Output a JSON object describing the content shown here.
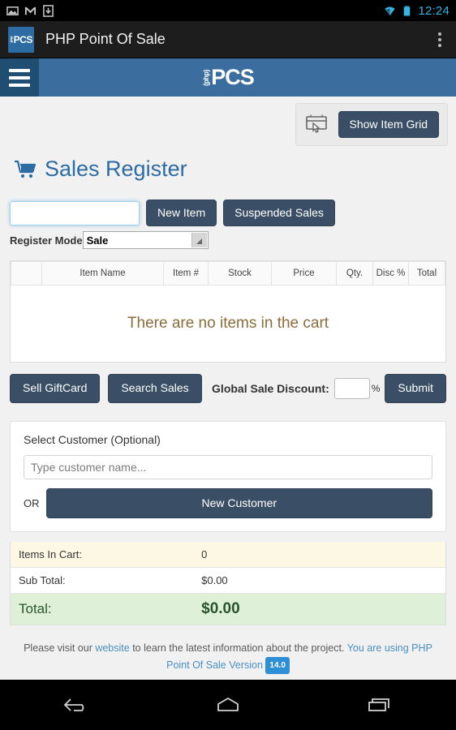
{
  "statusbar": {
    "icons": [
      "image-icon",
      "mail-icon",
      "download-icon",
      "wifi-icon",
      "battery-icon"
    ],
    "clock": "12:24"
  },
  "appbar": {
    "logo_text": "PCS",
    "logo_php": "(php)",
    "title": "PHP Point Of Sale",
    "overflow": "overflow-menu"
  },
  "sitenav": {
    "menu_icon": "hamburger-icon",
    "logo_php": "(php)",
    "logo_pcs": "PCS"
  },
  "toolbar": {
    "grid_icon": "item-grid-icon",
    "show_item_grid": "Show Item Grid"
  },
  "page": {
    "title": "Sales Register",
    "cart_icon": "shopping-cart-icon"
  },
  "register": {
    "scan_value": "",
    "scan_placeholder": "",
    "new_item": "New Item",
    "suspended_sales": "Suspended Sales",
    "mode_label": "Register Mode",
    "mode_value": "Sale",
    "mode_options": [
      "Sale"
    ]
  },
  "cart": {
    "columns": [
      "",
      "Item Name",
      "Item #",
      "Stock",
      "Price",
      "Qty.",
      "Disc %",
      "Total"
    ],
    "rows": [],
    "empty_message": "There are no items in the cart"
  },
  "actions": {
    "sell_giftcard": "Sell GiftCard",
    "search_sales": "Search Sales",
    "discount_label": "Global Sale Discount:",
    "discount_value": "",
    "percent": "%",
    "submit": "Submit"
  },
  "customer": {
    "title": "Select Customer (Optional)",
    "input_value": "",
    "input_placeholder": "Type customer name...",
    "or": "OR",
    "new_customer": "New Customer"
  },
  "totals": {
    "items_label": "Items In Cart:",
    "items_value": "0",
    "subtotal_label": "Sub Total:",
    "subtotal_value": "$0.00",
    "total_label": "Total:",
    "total_value": "$0.00"
  },
  "footer": {
    "text_1": "Please visit our ",
    "website_link": "website",
    "text_2": " to learn the latest information about the project. ",
    "version_link": "You are using PHP Point Of Sale Version",
    "version_badge": "14.0"
  },
  "navbar": {
    "back": "back-icon",
    "home": "home-icon",
    "recents": "recents-icon"
  },
  "colors": {
    "accent_blue": "#2d6ca2",
    "nav_blue": "#3b6e9f",
    "button_dark": "#3a4f66",
    "warning_text": "#8a6d3b",
    "total_bg": "#dff0d8",
    "total_text": "#2b542c",
    "items_bg": "#fcf8e3",
    "status_accent": "#33b5e5"
  }
}
